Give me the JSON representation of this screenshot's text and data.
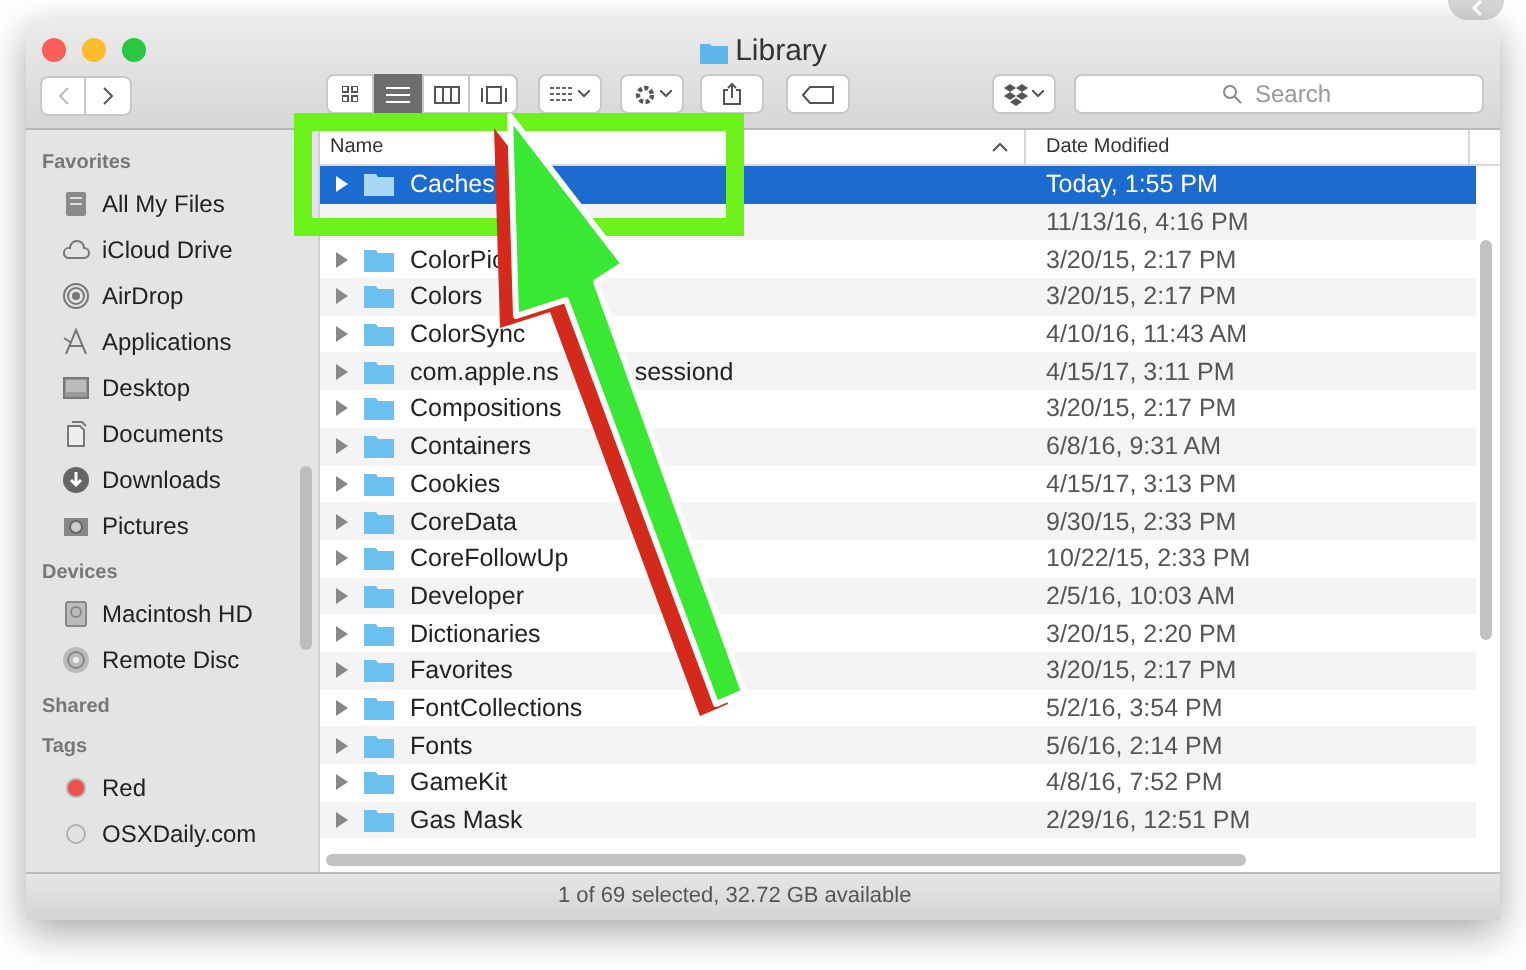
{
  "window": {
    "title": "Library"
  },
  "toolbar": {
    "search": {
      "placeholder": "Search"
    }
  },
  "sidebar": {
    "sections": [
      {
        "title": "Favorites",
        "items": [
          {
            "label": "All My Files"
          },
          {
            "label": "iCloud Drive"
          },
          {
            "label": "AirDrop"
          },
          {
            "label": "Applications"
          },
          {
            "label": "Desktop"
          },
          {
            "label": "Documents"
          },
          {
            "label": "Downloads"
          },
          {
            "label": "Pictures"
          }
        ]
      },
      {
        "title": "Devices",
        "items": [
          {
            "label": "Macintosh HD"
          },
          {
            "label": "Remote Disc"
          }
        ]
      },
      {
        "title": "Shared"
      },
      {
        "title": "Tags",
        "items": [
          {
            "label": "Red",
            "color": "#f0504a"
          },
          {
            "label": "OSXDaily.com",
            "color": "#e2e2e2"
          }
        ]
      }
    ]
  },
  "table": {
    "columns": [
      "Name",
      "Date Modified"
    ],
    "rows": [
      {
        "name": "Caches",
        "date": "Today, 1:55 PM",
        "selected": true
      },
      {
        "date": "11/13/16, 4:16 PM",
        "selected": false
      },
      {
        "name": "ColorPic",
        "date": "3/20/15, 2:17 PM",
        "selected": false
      },
      {
        "name": "Colors",
        "date": "3/20/15, 2:17 PM",
        "selected": false
      },
      {
        "name": "ColorSync",
        "date": "4/10/16, 11:43 AM",
        "selected": false
      },
      {
        "name": "com.apple.ns",
        "name_after_arrow": "sessiond",
        "date": "4/15/17, 3:11 PM",
        "selected": false
      },
      {
        "name": "Compositions",
        "date": "3/20/15, 2:17 PM",
        "selected": false
      },
      {
        "name": "Containers",
        "date": "6/8/16, 9:31 AM",
        "selected": false
      },
      {
        "name": "Cookies",
        "date": "4/15/17, 3:13 PM",
        "selected": false
      },
      {
        "name": "CoreData",
        "date": "9/30/15, 2:33 PM",
        "selected": false
      },
      {
        "name": "CoreFollowUp",
        "date": "10/22/15, 2:33 PM",
        "selected": false
      },
      {
        "name": "Developer",
        "date": "2/5/16, 10:03 AM",
        "selected": false
      },
      {
        "name": "Dictionaries",
        "date": "3/20/15, 2:20 PM",
        "selected": false
      },
      {
        "name": "Favorites",
        "date": "3/20/15, 2:17 PM",
        "selected": false
      },
      {
        "name": "FontCollections",
        "date": "5/2/16, 3:54 PM",
        "selected": false
      },
      {
        "name": "Fonts",
        "date": "5/6/16, 2:14 PM",
        "selected": false
      },
      {
        "name": "GameKit",
        "date": "4/8/16, 7:52 PM",
        "selected": false
      },
      {
        "name": "Gas Mask",
        "date": "2/29/16, 12:51 PM",
        "selected": false
      }
    ]
  },
  "status_bar": "1 of 69 selected, 32.72 GB available"
}
